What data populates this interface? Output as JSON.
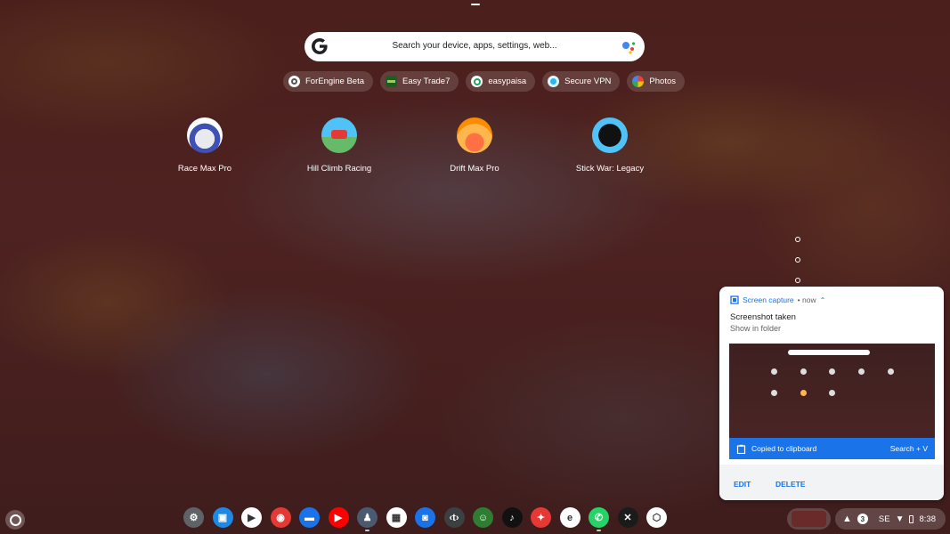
{
  "search": {
    "placeholder": "Search your device, apps, settings, web..."
  },
  "chips": [
    {
      "label": "ForEngine Beta",
      "icon": "forengine-icon",
      "color": "#ffffff"
    },
    {
      "label": "Easy Trade7",
      "icon": "easytrade-icon",
      "color": "#2e7d32"
    },
    {
      "label": "easypaisa",
      "icon": "easypaisa-icon",
      "color": "#1fa463"
    },
    {
      "label": "Secure VPN",
      "icon": "vpn-icon",
      "color": "#29b6f6"
    },
    {
      "label": "Photos",
      "icon": "photos-icon",
      "color": "#fbbc04"
    }
  ],
  "apps": [
    {
      "label": "Race Max Pro",
      "icon": "race-max-pro-icon"
    },
    {
      "label": "Hill Climb Racing",
      "icon": "hill-climb-racing-icon"
    },
    {
      "label": "Drift Max Pro",
      "icon": "drift-max-pro-icon"
    },
    {
      "label": "Stick War: Legacy",
      "icon": "stick-war-legacy-icon"
    }
  ],
  "notification": {
    "app_name": "Screen capture",
    "time": "• now",
    "title": "Screenshot taken",
    "subtitle": "Show in folder",
    "bar_text": "Copied to clipboard",
    "shortcut": "Search + V",
    "edit_label": "EDIT",
    "delete_label": "DELETE"
  },
  "shelf": [
    {
      "name": "settings-icon",
      "color": "#5f6368",
      "glyph": "⚙"
    },
    {
      "name": "camera-app-icon",
      "color": "#1e88e5",
      "glyph": "▣"
    },
    {
      "name": "play-store-icon",
      "color": "#ffffff",
      "glyph": "▶"
    },
    {
      "name": "chrome-icon",
      "color": "#e53935",
      "glyph": "◉"
    },
    {
      "name": "files-icon",
      "color": "#1a73e8",
      "glyph": "▬"
    },
    {
      "name": "youtube-icon",
      "color": "#ff0000",
      "glyph": "▶"
    },
    {
      "name": "game-icon",
      "color": "#4a5a70",
      "glyph": "♟"
    },
    {
      "name": "app-icon",
      "color": "#ffffff",
      "glyph": "▦"
    },
    {
      "name": "screenshot-icon",
      "color": "#1a73e8",
      "glyph": "◙"
    },
    {
      "name": "terminal-icon",
      "color": "#3c4043",
      "glyph": "‹t›"
    },
    {
      "name": "emoji-icon",
      "color": "#2e7d32",
      "glyph": "☺"
    },
    {
      "name": "tiktok-icon",
      "color": "#111111",
      "glyph": "♪"
    },
    {
      "name": "game-icon-2",
      "color": "#e53935",
      "glyph": "✦"
    },
    {
      "name": "easypaisa-shelf-icon",
      "color": "#ffffff",
      "glyph": "e"
    },
    {
      "name": "whatsapp-icon",
      "color": "#25d366",
      "glyph": "✆"
    },
    {
      "name": "stick-war-shelf-icon",
      "color": "#1b1b1b",
      "glyph": "✕"
    },
    {
      "name": "box-icon",
      "color": "#ffffff",
      "glyph": "⬡"
    }
  ],
  "status": {
    "notification_count": "3",
    "ime": "SE",
    "time": "8:38"
  }
}
